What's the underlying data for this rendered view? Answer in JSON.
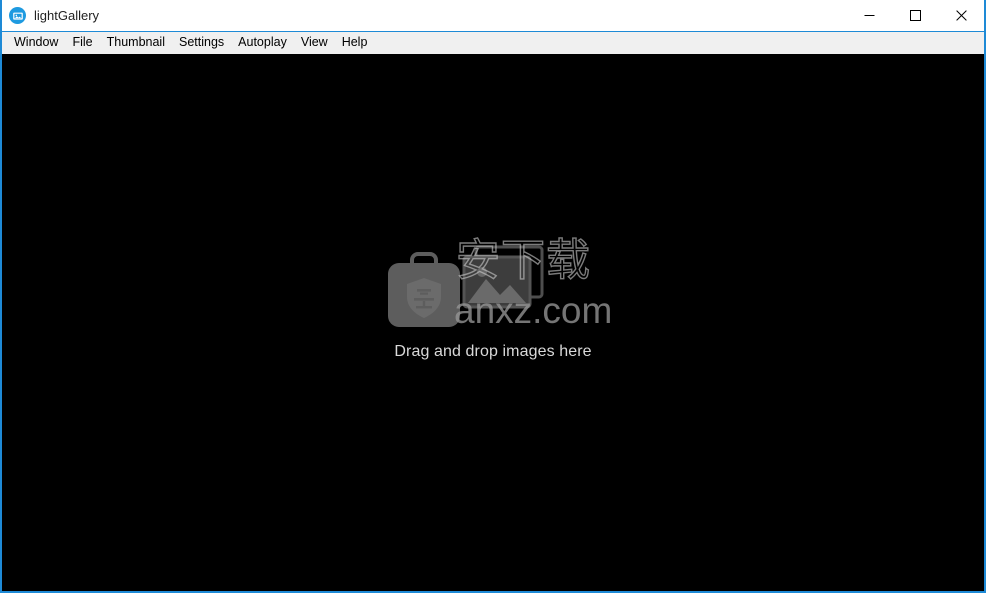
{
  "window": {
    "title": "lightGallery",
    "app_icon": "gallery-icon",
    "accent_color": "#1e8ad6",
    "titlebar_bg": "#ffffff",
    "menubar_bg": "#f0f0f0",
    "canvas_bg": "#000000",
    "controls": {
      "minimize": "minimize-icon",
      "maximize": "maximize-icon",
      "close": "close-icon"
    }
  },
  "menubar": {
    "items": [
      {
        "label": "Window"
      },
      {
        "label": "File"
      },
      {
        "label": "Thumbnail"
      },
      {
        "label": "Settings"
      },
      {
        "label": "Autoplay"
      },
      {
        "label": "View"
      },
      {
        "label": "Help"
      }
    ]
  },
  "canvas": {
    "dropzone": {
      "message": "Drag and drop images here",
      "message_color": "#d9d9d9",
      "bag_icon": "briefcase-shield-icon",
      "shield_char": "安",
      "photo_icon": "image-placeholder-icon"
    },
    "watermark": {
      "characters": "安下载",
      "domain": "anxz.com",
      "color": "#969696"
    }
  }
}
